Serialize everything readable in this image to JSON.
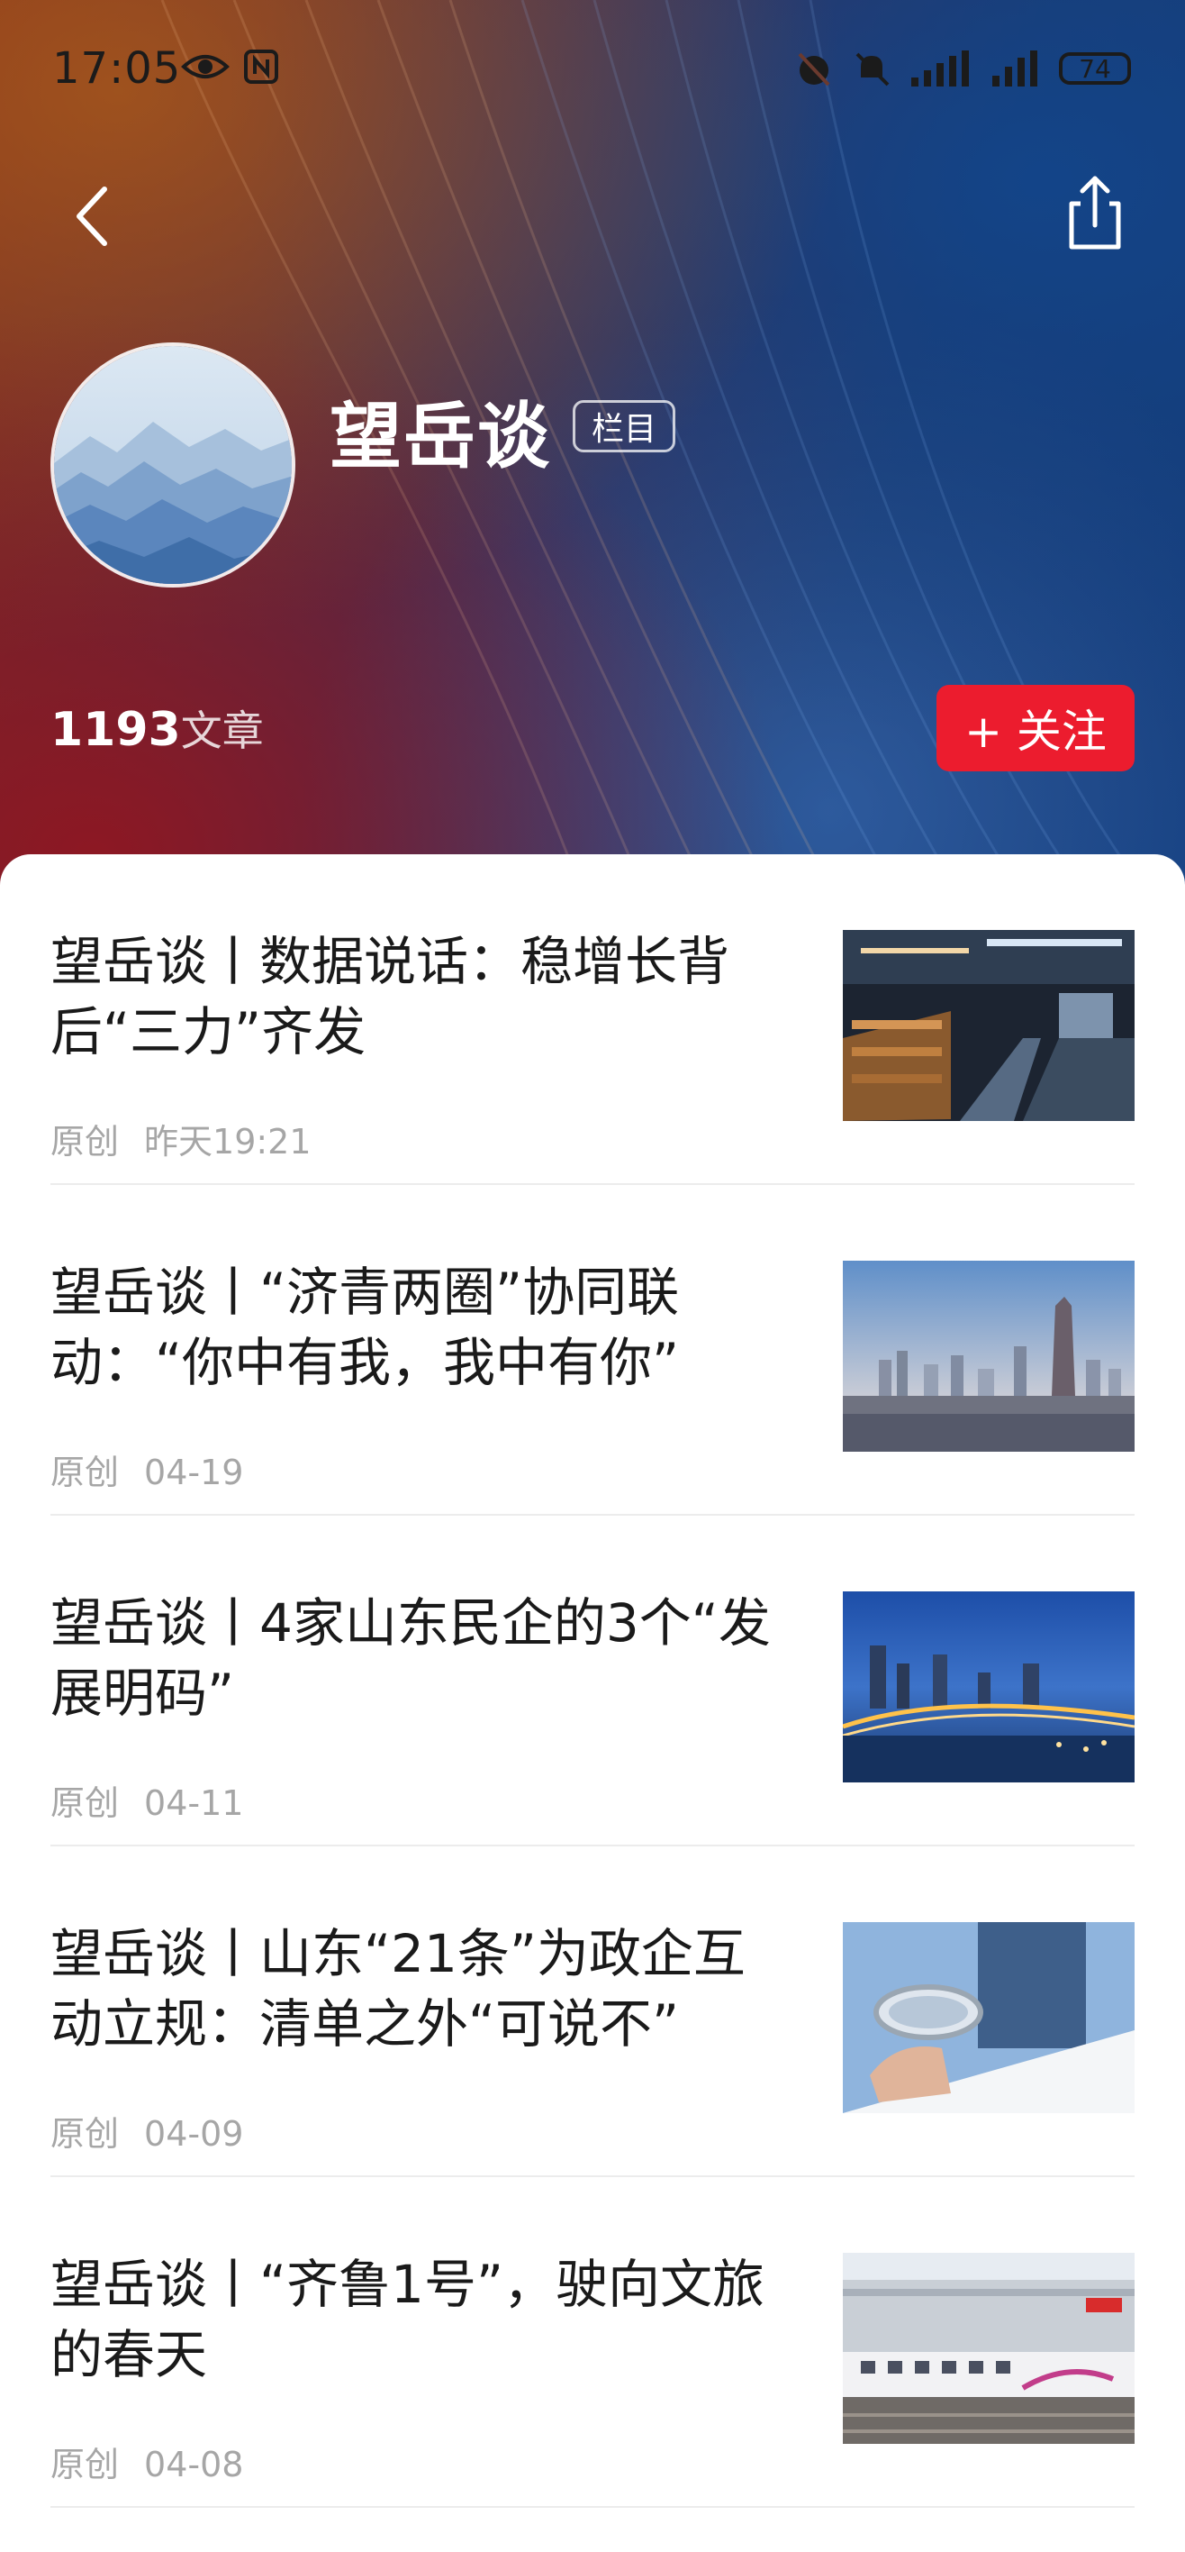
{
  "status_bar": {
    "time": "17:05",
    "battery": "74",
    "icons": [
      "eye-icon",
      "nfc-icon",
      "alarm-icon",
      "mute-icon",
      "signal-icon",
      "signal-icon",
      "battery-icon"
    ]
  },
  "nav": {
    "back_icon": "chevron-left-icon",
    "share_icon": "share-icon"
  },
  "channel": {
    "name": "望岳谈",
    "tag": "栏目",
    "article_count": "1193",
    "article_unit": "文章",
    "follow_label": "+ 关注"
  },
  "colors": {
    "accent_red": "#ec1c2e",
    "title_text": "#1a1a1a",
    "meta_text": "#a6a6a6",
    "divider": "#ececec"
  },
  "articles": [
    {
      "title": "望岳谈丨数据说话：稳增长背后“三力”齐发",
      "source": "原创",
      "date": "昨天19:21"
    },
    {
      "title": "望岳谈丨“济青两圈”协同联动：“你中有我，我中有你”",
      "source": "原创",
      "date": "04-19"
    },
    {
      "title": "望岳谈丨4家山东民企的3个“发展明码”",
      "source": "原创",
      "date": "04-11"
    },
    {
      "title": "望岳谈丨山东“21条”为政企互动立规：清单之外“可说不”",
      "source": "原创",
      "date": "04-09"
    },
    {
      "title": "望岳谈丨“齐鲁1号”，驶向文旅的春天",
      "source": "原创",
      "date": "04-08"
    }
  ]
}
